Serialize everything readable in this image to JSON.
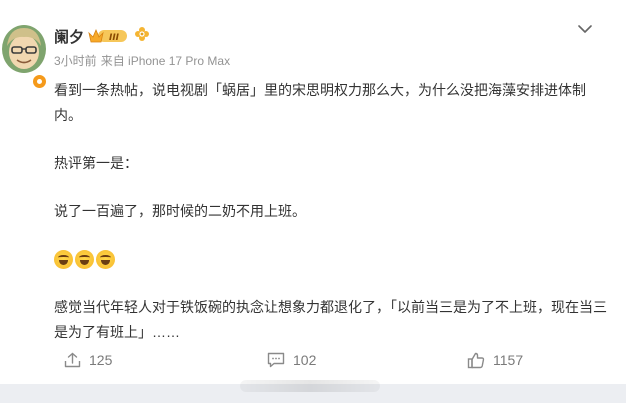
{
  "post": {
    "username": "阑夕",
    "level_badge": "III",
    "time": "3小时前",
    "source": "来自 iPhone 17 Pro Max",
    "paragraphs": [
      "看到一条热帖，说电视剧「蜗居」里的宋思明权力那么大，为什么没把海藻安排进体制内。",
      "热评第一是：",
      "说了一百遍了，那时候的二奶不用上班。",
      "感觉当代年轻人对于铁饭碗的执念让想象力都退化了，「以前当三是为了不上班，现在当三是为了有班上」……"
    ],
    "emojis": [
      "laugh-cry-emoji",
      "laugh-cry-emoji",
      "laugh-cry-emoji"
    ]
  },
  "actions": {
    "share_count": "125",
    "comment_count": "102",
    "like_count": "1157"
  },
  "icons": {
    "share": "share-icon",
    "comment": "comment-icon",
    "like": "thumbs-up-icon",
    "menu": "chevron-down-icon"
  },
  "colors": {
    "text": "#333333",
    "meta": "#939393",
    "badge_orange": "#f59a1b",
    "background": "#f0f1f4"
  }
}
